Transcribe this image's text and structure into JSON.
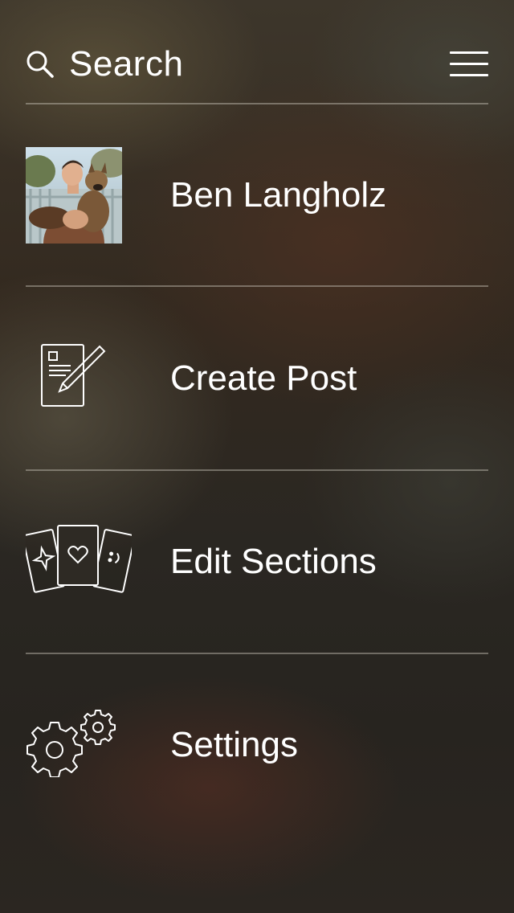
{
  "header": {
    "search_label": "Search",
    "search_icon": "search-icon",
    "menu_icon": "hamburger-menu-icon"
  },
  "menu": {
    "items": [
      {
        "label": "Ben Langholz",
        "icon": "avatar"
      },
      {
        "label": "Create Post",
        "icon": "compose-icon"
      },
      {
        "label": "Edit Sections",
        "icon": "cards-icon"
      },
      {
        "label": "Settings",
        "icon": "gears-icon"
      }
    ]
  },
  "colors": {
    "text": "#ffffff",
    "divider": "#c8c3b9",
    "background": "#2b2722"
  }
}
